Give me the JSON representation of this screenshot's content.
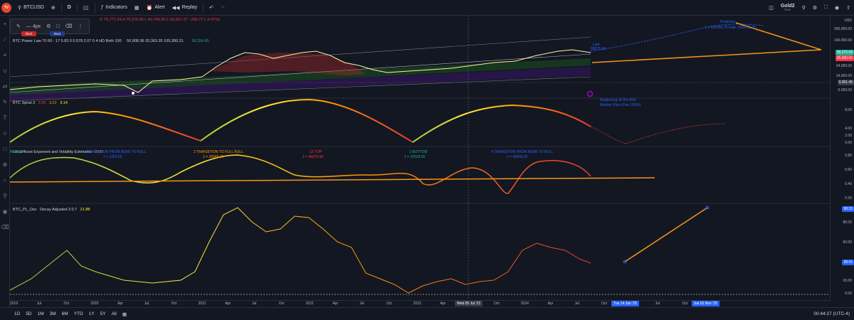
{
  "topbar": {
    "symbol": "BTCUSD",
    "interval": "D",
    "indicators": "Indicators",
    "alert": "Alert",
    "replay": "Replay",
    "account": "Gold2",
    "account_sub": "New"
  },
  "legend": {
    "ohlc": "O 75,771.24  H 75,975.99  L 49,749.99  C 65,567.27  −265.77 (−0.47%)",
    "power_law": "BTC Power Law  70 60 - 17 5.83 0 0.578 2.07 0 4 HD Both 100",
    "power_law_vals": "50,908.36  20,363.35  105,380.31",
    "power_law_val2": "28,324.85",
    "spiral_name": "BTC Spiral 3",
    "spiral_vals": [
      "3.35",
      "3.22",
      "3.14"
    ],
    "hurst_name": "Local Hurst Exponent and Volatility Estimates",
    "hurst_val": "0.60",
    "osc_name": "BTC_PL_Osc",
    "osc_params": "Decay Adjusted  3 0.7",
    "osc_val": "21.88"
  },
  "annotations": {
    "projection_label": "Projected",
    "projection_value": "1 = 305990.78  Date: 2026.01.25",
    "last_label": "Last",
    "last_value": "58575.68",
    "bull_note_1": "Beginning of the Bull",
    "bull_note_2": "Market (Nov-Dec 2024)",
    "spiral_labels": [
      "BOTTOM",
      "4 TRANSITION FROM BEAR TO BULL",
      "3 TRANSITION TO FULL BULL",
      "12 TOP",
      "1 BOTTOM",
      "4 TRANSITION FROM BEAR TO BULL"
    ],
    "spiral_sublabels": [
      "1 = 1355.65",
      "1 = 28985.49",
      "1 = 46970.56",
      "1 = 16529.50",
      "1 = 40839.32"
    ]
  },
  "price_axis": {
    "main": [
      "USD",
      "300,000.00",
      "140,000.00",
      "58,575.68",
      "35,000.00",
      "34,000.00",
      "14,000.00",
      "9,901.45",
      "6,000.00"
    ],
    "main_badge_green": "58,575.68",
    "main_badge_red": "35,000.00",
    "main_badge_gray": "9,901.45",
    "spiral": [
      "8.00",
      "4.00",
      "2.00",
      "0.00"
    ],
    "hurst": [
      "0.80",
      "0.60",
      "0.40",
      "0.20"
    ],
    "osc": [
      "100.00",
      "80.00",
      "60.00",
      "40.00",
      "20.00",
      "0.00"
    ],
    "osc_badge_top": "98.33",
    "osc_badge": "38.41"
  },
  "time_axis": {
    "labels": [
      "2019",
      "Jul",
      "Oct",
      "2020",
      "Apr",
      "Jul",
      "Oct",
      "2021",
      "Apr",
      "Jul",
      "Oct",
      "2022",
      "Apr",
      "Jul",
      "Oct",
      "2023",
      "Apr",
      "Jul",
      "Oct",
      "2024",
      "Apr",
      "Jul",
      "Oct",
      "Apr",
      "Jul",
      "Oct",
      "2026"
    ],
    "crosshair_date": "Wed 05 Jul '23",
    "range_start": "Tue 14 Jan '25",
    "range_end": "Sat 01 Nov '25"
  },
  "bottombar": {
    "ranges": [
      "1D",
      "5D",
      "1M",
      "3M",
      "6M",
      "YTD",
      "1Y",
      "5Y",
      "All"
    ],
    "clock": "00:44:27 (UTC-4)"
  },
  "drawtools": {
    "stroke": "4px"
  },
  "chips": {
    "red": "Rect",
    "blue": "Rect"
  },
  "colors": {
    "background": "#131722",
    "orange": "#f7931a",
    "blue_dots": "#2962ff",
    "green_badge": "#22ab94",
    "red_badge": "#f23645"
  }
}
